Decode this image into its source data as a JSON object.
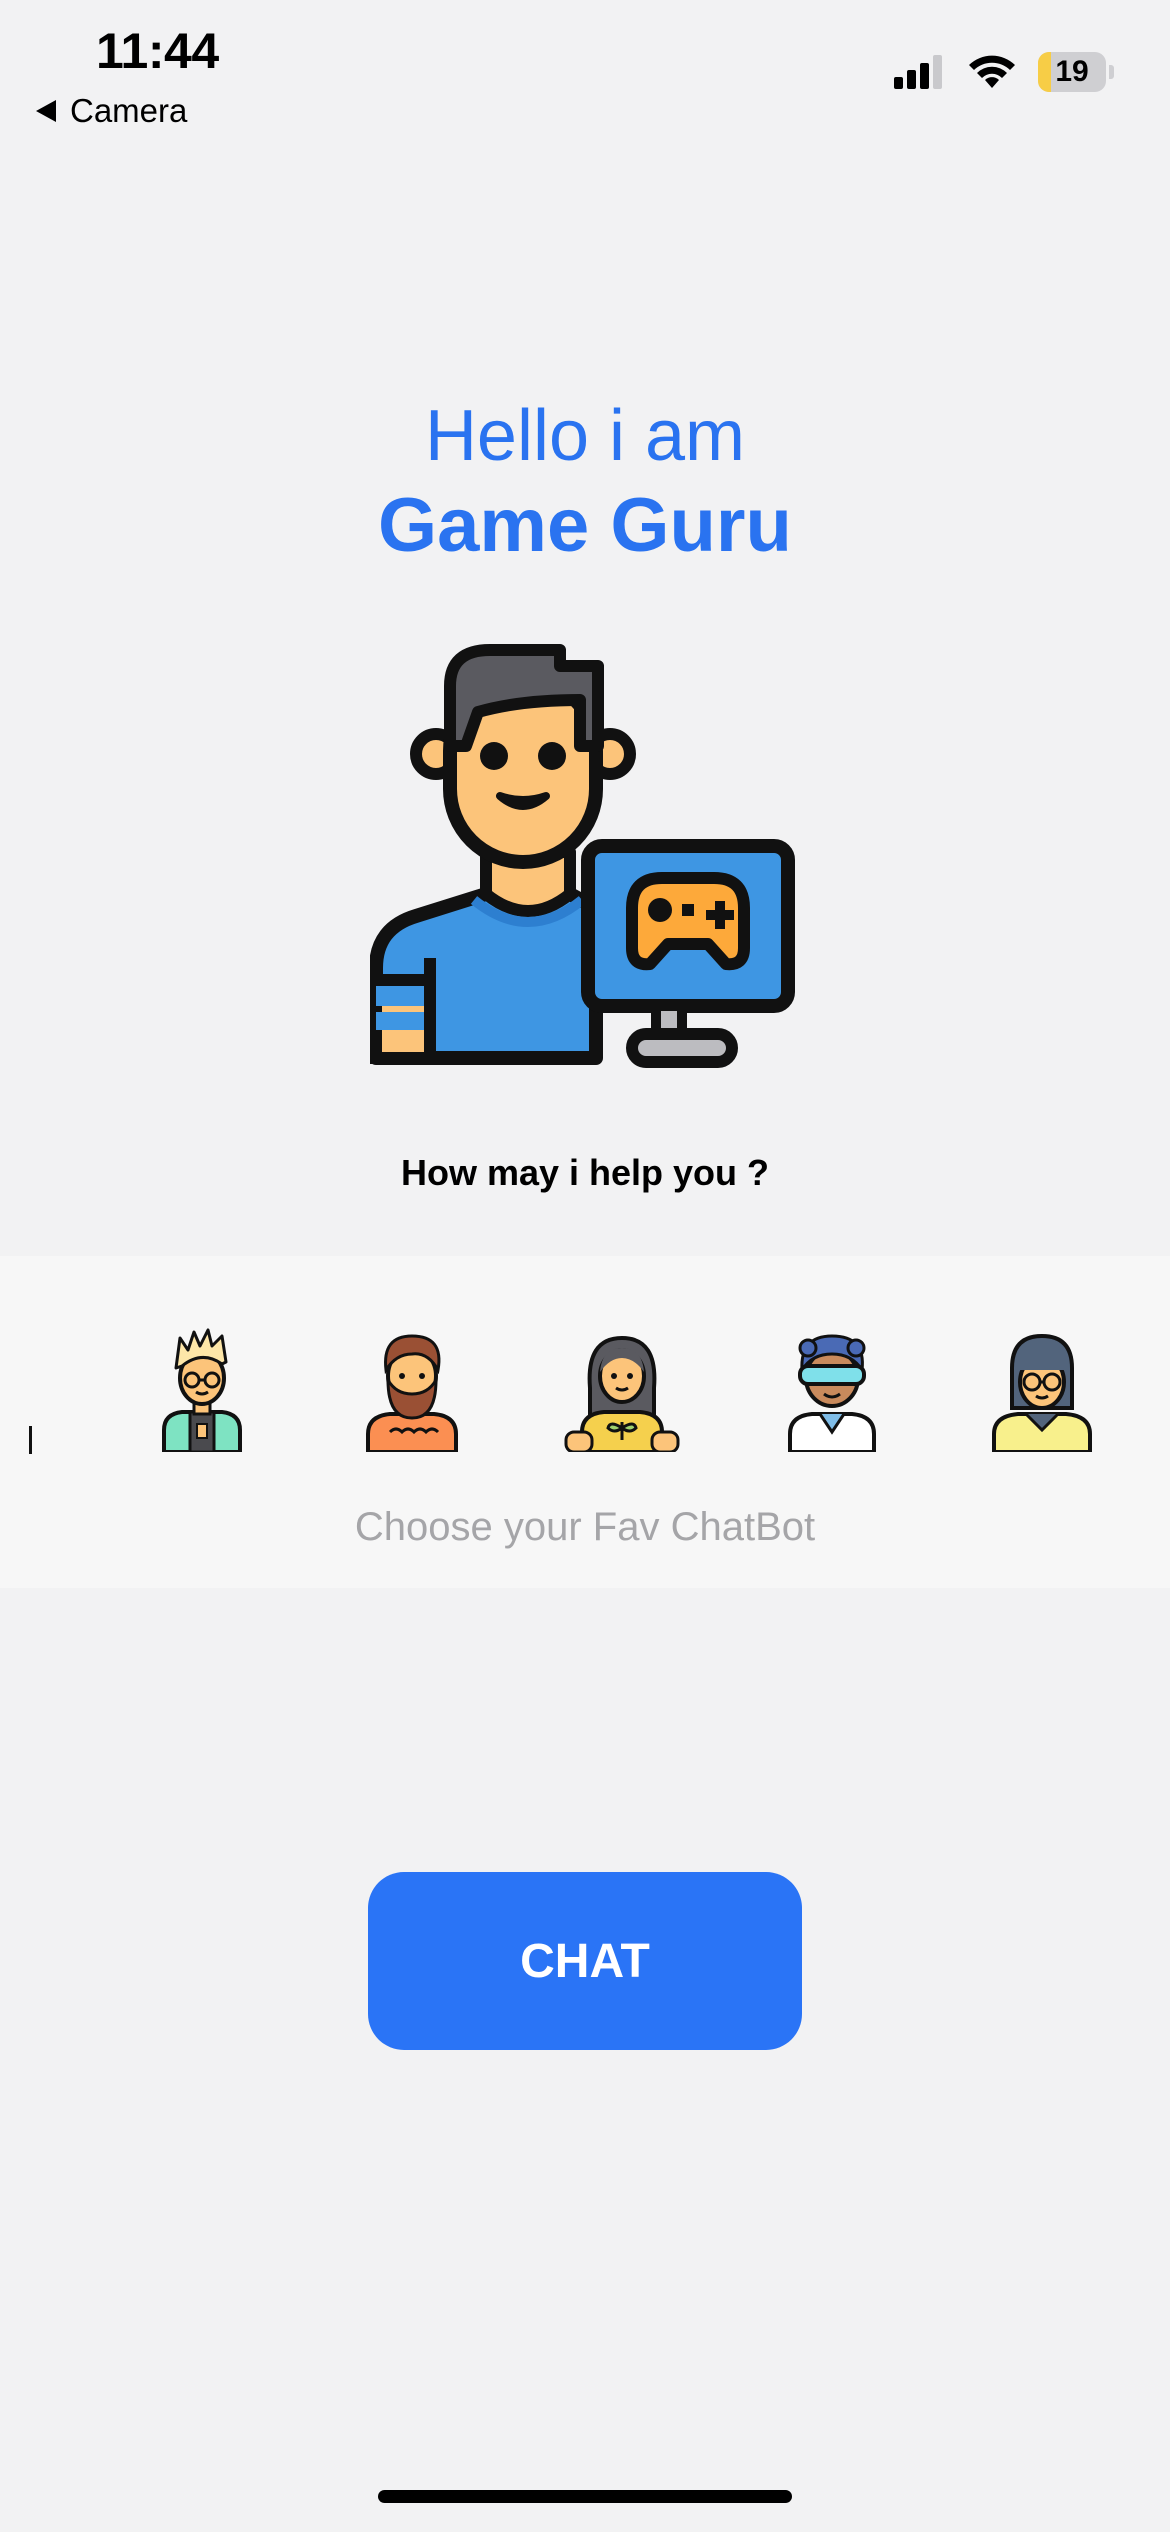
{
  "status_bar": {
    "time": "11:44",
    "back_label": "Camera",
    "battery_level": "19",
    "battery_fraction": 0.19,
    "icons": [
      "signal-icon",
      "wifi-icon",
      "battery-icon"
    ]
  },
  "greeting": {
    "line1": "Hello i am",
    "bot_name": "Game Guru"
  },
  "prompt": "How may i help you ?",
  "bot_selector": {
    "caption": "Choose your Fav ChatBot",
    "avatars": [
      "nerd-bot-avatar",
      "bearded-bot-avatar",
      "plant-bot-avatar",
      "scientist-bot-avatar",
      "glasses-bot-avatar"
    ]
  },
  "actions": {
    "chat_label": "CHAT"
  },
  "colors": {
    "accent": "#2a73f0",
    "button": "#2a74f6",
    "background": "#f2f2f3"
  }
}
